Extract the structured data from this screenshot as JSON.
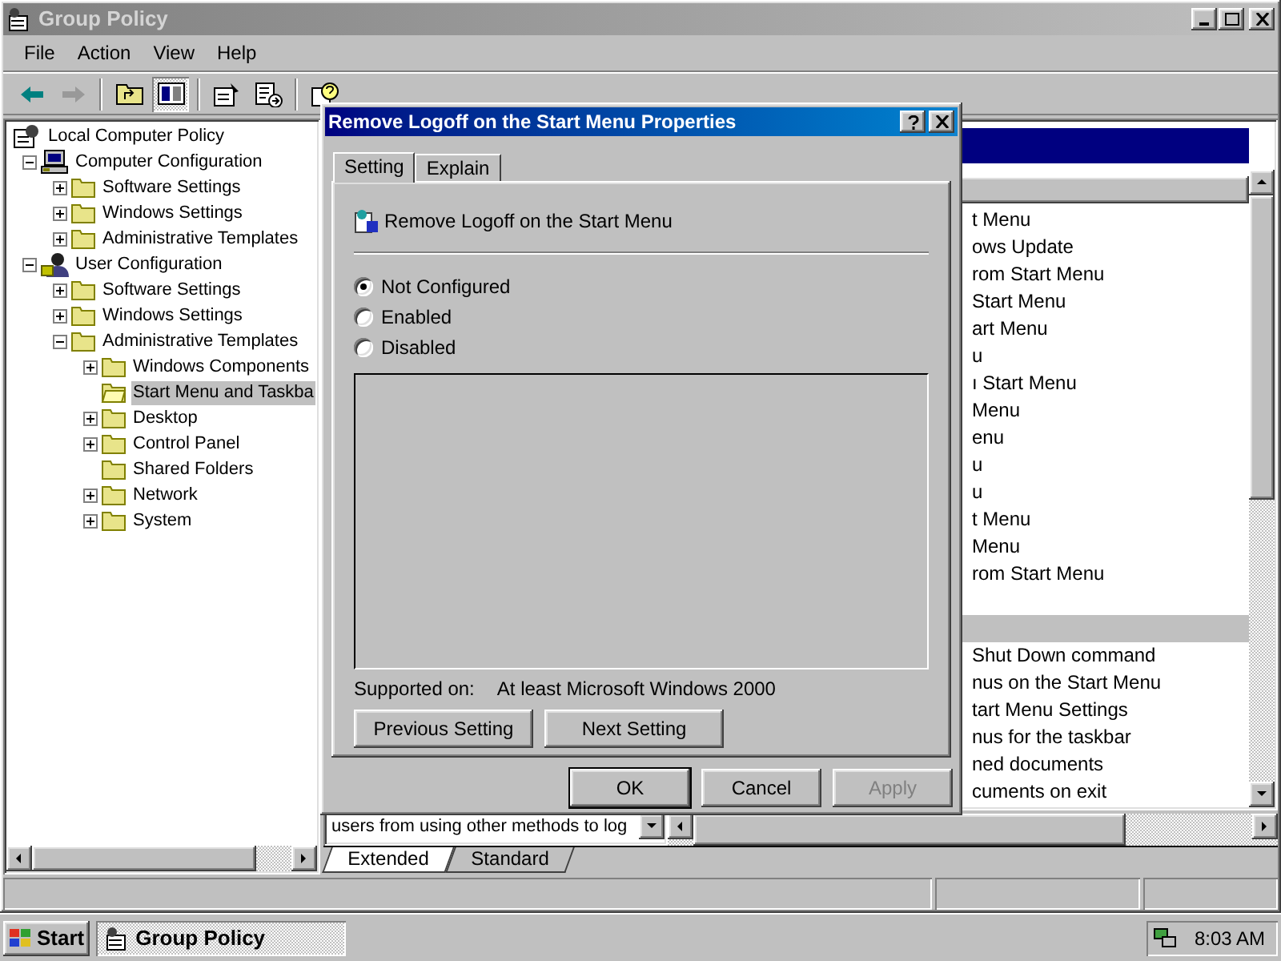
{
  "window": {
    "title": "Group Policy"
  },
  "menu": [
    "File",
    "Action",
    "View",
    "Help"
  ],
  "toolbar": [
    {
      "kind": "back",
      "pressed": false,
      "disabled": false
    },
    {
      "kind": "forward",
      "pressed": false,
      "disabled": true
    },
    {
      "kind": "separator"
    },
    {
      "kind": "up",
      "pressed": false,
      "disabled": false
    },
    {
      "kind": "tree",
      "pressed": true,
      "disabled": false
    },
    {
      "kind": "separator"
    },
    {
      "kind": "properties",
      "pressed": false,
      "disabled": false
    },
    {
      "kind": "export",
      "pressed": false,
      "disabled": false
    },
    {
      "kind": "separator"
    },
    {
      "kind": "help",
      "pressed": false,
      "disabled": false
    }
  ],
  "tree": [
    {
      "label": "Local Computer Policy",
      "kind": "policy",
      "selected": false,
      "children": [
        {
          "label": "Computer Configuration",
          "kind": "computer",
          "selected": false,
          "expanded": true,
          "children": [
            {
              "label": "Software Settings",
              "kind": "folder",
              "selected": false,
              "expanded": false
            },
            {
              "label": "Windows Settings",
              "kind": "folder",
              "selected": false,
              "expanded": false
            },
            {
              "label": "Administrative Templates",
              "kind": "folder",
              "selected": false,
              "expanded": false
            }
          ]
        },
        {
          "label": "User Configuration",
          "kind": "user",
          "selected": false,
          "expanded": true,
          "children": [
            {
              "label": "Software Settings",
              "kind": "folder",
              "selected": false,
              "expanded": false
            },
            {
              "label": "Windows Settings",
              "kind": "folder",
              "selected": false,
              "expanded": false
            },
            {
              "label": "Administrative Templates",
              "kind": "folder",
              "selected": false,
              "expanded": true,
              "children": [
                {
                  "label": "Windows Components",
                  "kind": "folder",
                  "selected": false,
                  "expanded": false
                },
                {
                  "label": "Start Menu and Taskba",
                  "kind": "folder",
                  "selected": true
                },
                {
                  "label": "Desktop",
                  "kind": "folder",
                  "selected": false,
                  "expanded": false
                },
                {
                  "label": "Control Panel",
                  "kind": "folder",
                  "selected": false,
                  "expanded": false
                },
                {
                  "label": "Shared Folders",
                  "kind": "folder",
                  "selected": false
                },
                {
                  "label": "Network",
                  "kind": "folder",
                  "selected": false,
                  "expanded": false
                },
                {
                  "label": "System",
                  "kind": "folder",
                  "selected": false,
                  "expanded": false
                }
              ]
            }
          ]
        }
      ]
    }
  ],
  "list": [
    {
      "text": "t Menu",
      "selected": false
    },
    {
      "text": "ows Update",
      "selected": false
    },
    {
      "text": "rom Start Menu",
      "selected": false
    },
    {
      "text": "Start Menu",
      "selected": false
    },
    {
      "text": "art Menu",
      "selected": false
    },
    {
      "text": "u",
      "selected": false
    },
    {
      "text": "ı Start Menu",
      "selected": false
    },
    {
      "text": "Menu",
      "selected": false
    },
    {
      "text": "enu",
      "selected": false
    },
    {
      "text": "u",
      "selected": false
    },
    {
      "text": "u",
      "selected": false
    },
    {
      "text": "t Menu",
      "selected": false
    },
    {
      "text": "Menu",
      "selected": false
    },
    {
      "text": "rom Start Menu",
      "selected": false
    },
    {
      "selected": false
    },
    {
      "selected": true
    },
    {
      "text": "Shut Down command",
      "selected": false
    },
    {
      "text": "nus on the Start Menu",
      "selected": false
    },
    {
      "text": "tart Menu Settings",
      "selected": false
    },
    {
      "text": "nus for the taskbar",
      "selected": false
    },
    {
      "text": "ned documents",
      "selected": false
    },
    {
      "text": "cuments on exit",
      "selected": false
    }
  ],
  "description": "users from using other methods to log",
  "view_tabs": [
    {
      "label": "Extended",
      "selected": true
    },
    {
      "label": "Standard",
      "selected": false
    }
  ],
  "dialog": {
    "title": "Remove Logoff on the Start Menu Properties",
    "tabs": [
      {
        "label": "Setting",
        "selected": true
      },
      {
        "label": "Explain",
        "selected": false
      }
    ],
    "policy": "Remove Logoff on the Start Menu",
    "options": [
      {
        "label": "Not Configured",
        "selected": true
      },
      {
        "label": "Enabled",
        "selected": false
      },
      {
        "label": "Disabled",
        "selected": false
      }
    ],
    "supported_label": "Supported on:",
    "supported_value": "At least Microsoft Windows 2000",
    "nav_buttons": [
      "Previous Setting",
      "Next Setting"
    ],
    "buttons": [
      {
        "label": "OK",
        "disabled": false,
        "default": true
      },
      {
        "label": "Cancel",
        "disabled": false,
        "default": false
      },
      {
        "label": "Apply",
        "disabled": true,
        "default": false
      }
    ]
  },
  "taskbar": {
    "start": "Start",
    "tasks": [
      {
        "label": "Group Policy",
        "selected": true
      }
    ],
    "clock": "8:03 AM"
  }
}
